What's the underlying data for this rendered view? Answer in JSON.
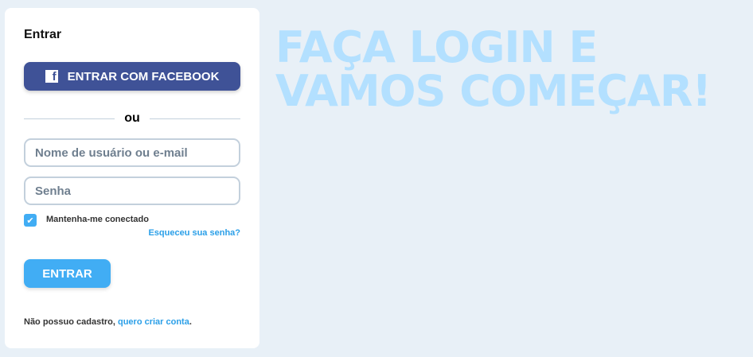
{
  "login": {
    "title": "Entrar",
    "facebook_label": "ENTRAR COM FACEBOOK",
    "facebook_icon": "f",
    "separator": "ou",
    "username_placeholder": "Nome de usuário ou e-mail",
    "password_placeholder": "Senha",
    "remember_label": "Mantenha-me conectado",
    "remember_checked": true,
    "forgot_label": "Esqueceu sua senha?",
    "submit_label": "ENTRAR",
    "signup_text": "Não possuo cadastro, ",
    "signup_link": "quero criar conta",
    "signup_end": "."
  },
  "headline": "FAÇA LOGIN E VAMOS COMEÇAR!",
  "colors": {
    "facebook": "#3f5297",
    "accent": "#41adf4",
    "link": "#2a9fe8",
    "headline": "#b3e0ff",
    "background": "#e8f0f7"
  }
}
